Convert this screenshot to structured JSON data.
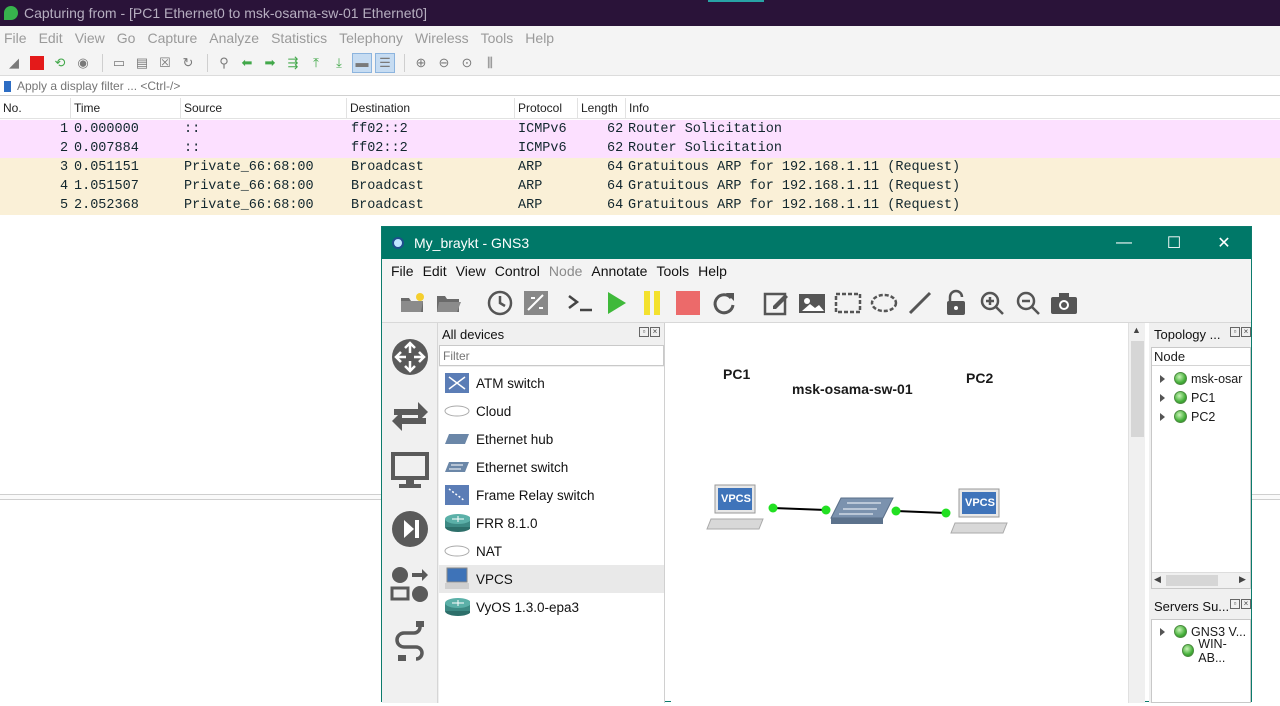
{
  "wireshark": {
    "title": "Capturing from - [PC1 Ethernet0 to msk-osama-sw-01 Ethernet0]",
    "menu": [
      "File",
      "Edit",
      "View",
      "Go",
      "Capture",
      "Analyze",
      "Statistics",
      "Telephony",
      "Wireless",
      "Tools",
      "Help"
    ],
    "filter_placeholder": "Apply a display filter ... <Ctrl-/>",
    "columns": [
      "No.",
      "Time",
      "Source",
      "Destination",
      "Protocol",
      "Length",
      "Info"
    ],
    "packets": [
      {
        "no": "1",
        "time": "0.000000",
        "source": "::",
        "destination": "ff02::2",
        "protocol": "ICMPv6",
        "length": "62",
        "info": "Router Solicitation",
        "color": "#fce0ff"
      },
      {
        "no": "2",
        "time": "0.007884",
        "source": "::",
        "destination": "ff02::2",
        "protocol": "ICMPv6",
        "length": "62",
        "info": "Router Solicitation",
        "color": "#fce0ff"
      },
      {
        "no": "3",
        "time": "0.051151",
        "source": "Private_66:68:00",
        "destination": "Broadcast",
        "protocol": "ARP",
        "length": "64",
        "info": "Gratuitous ARP for 192.168.1.11 (Request)",
        "color": "#faf0d7"
      },
      {
        "no": "4",
        "time": "1.051507",
        "source": "Private_66:68:00",
        "destination": "Broadcast",
        "protocol": "ARP",
        "length": "64",
        "info": "Gratuitous ARP for 192.168.1.11 (Request)",
        "color": "#faf0d7"
      },
      {
        "no": "5",
        "time": "2.052368",
        "source": "Private_66:68:00",
        "destination": "Broadcast",
        "protocol": "ARP",
        "length": "64",
        "info": "Gratuitous ARP for 192.168.1.11 (Request)",
        "color": "#faf0d7"
      }
    ]
  },
  "gns3": {
    "title": "My_braykt - GNS3",
    "menu": [
      "File",
      "Edit",
      "View",
      "Control",
      "Node",
      "Annotate",
      "Tools",
      "Help"
    ],
    "devices_panel": {
      "title": "All devices",
      "filter_placeholder": "Filter",
      "items": [
        "ATM switch",
        "Cloud",
        "Ethernet hub",
        "Ethernet switch",
        "Frame Relay switch",
        "FRR 8.1.0",
        "NAT",
        "VPCS",
        "VyOS 1.3.0-epa3"
      ],
      "selected": "VPCS"
    },
    "canvas": {
      "nodes": [
        {
          "name": "PC1",
          "badge": "VPCS"
        },
        {
          "name": "msk-osama-sw-01"
        },
        {
          "name": "PC2",
          "badge": "VPCS"
        }
      ]
    },
    "topology_panel": {
      "title": "Topology ...",
      "column": "Node",
      "nodes": [
        "msk-osar",
        "PC1",
        "PC2"
      ]
    },
    "servers_panel": {
      "title": "Servers Su...",
      "servers": [
        "GNS3 V...",
        "WIN-AB..."
      ]
    }
  }
}
